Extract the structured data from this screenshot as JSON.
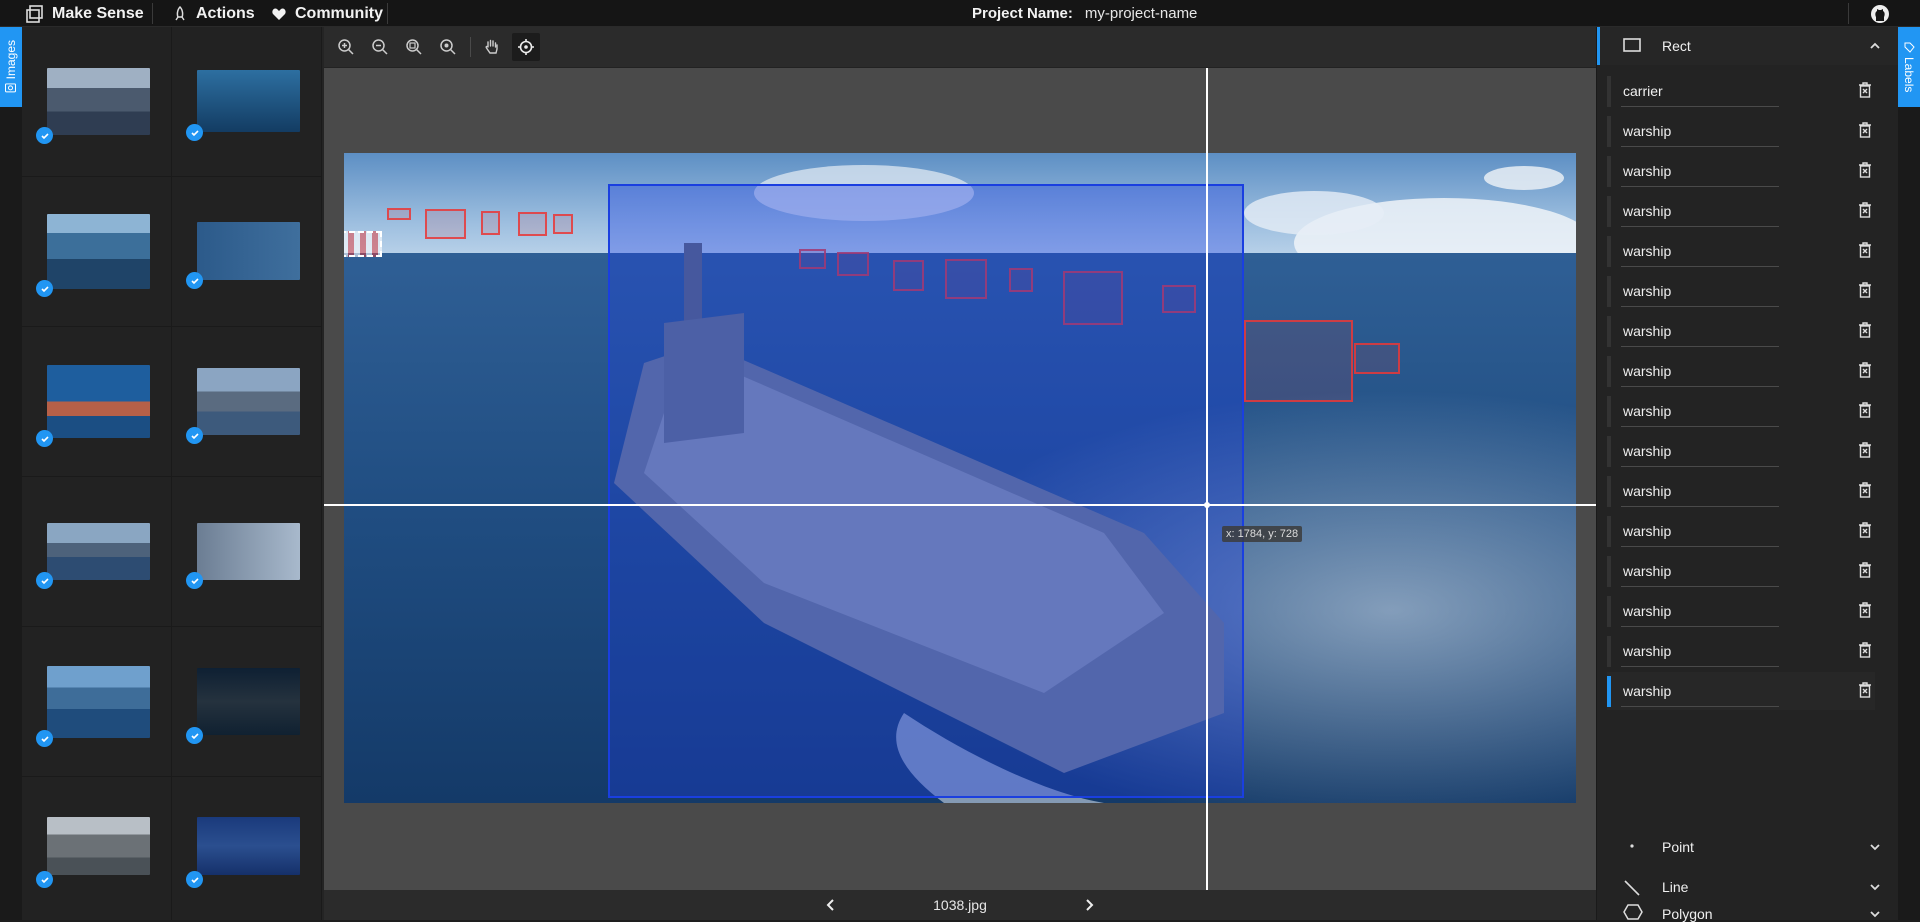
{
  "topbar": {
    "app_name": "Make Sense",
    "actions_label": "Actions",
    "community_label": "Community",
    "project_label": "Project Name:",
    "project_name": "my-project-name"
  },
  "left_panel": {
    "tab_label": "Images"
  },
  "right_panel": {
    "tab_label": "Labels",
    "rect_section_title": "Rect",
    "labels": [
      "carrier",
      "warship",
      "warship",
      "warship",
      "warship",
      "warship",
      "warship",
      "warship",
      "warship",
      "warship",
      "warship",
      "warship",
      "warship",
      "warship",
      "warship",
      "warship"
    ],
    "selected_label_index": 15,
    "point_section_title": "Point",
    "line_section_title": "Line",
    "polygon_section_title": "Polygon"
  },
  "canvas": {
    "cursor_readout": "x: 1784, y: 728"
  },
  "bottombar": {
    "filename": "1038.jpg"
  },
  "colors": {
    "accent": "#2196f3",
    "rect_red": "#e73838",
    "rect_blue": "#1a3fe0"
  }
}
